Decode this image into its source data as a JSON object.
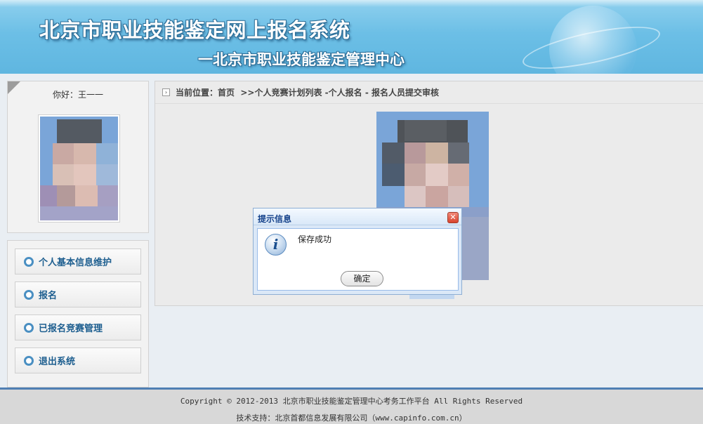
{
  "header": {
    "title": "北京市职业技能鉴定网上报名系统",
    "subtitle": "一北京市职业技能鉴定管理中心"
  },
  "sidebar": {
    "greeting": "你好：王一一",
    "menu": [
      {
        "label": "个人基本信息维护"
      },
      {
        "label": "报名"
      },
      {
        "label": "已报名竞赛管理"
      },
      {
        "label": "退出系统"
      }
    ]
  },
  "breadcrumb": {
    "prefix": "当前位置：",
    "path": "首页  >>个人竞赛计划列表 -个人报名 - 报名人员提交审核"
  },
  "dialog": {
    "title": "提示信息",
    "message": "保存成功",
    "ok_label": "确定",
    "close_glyph": "✕",
    "icon": "info-icon"
  },
  "footer": {
    "copyright": "Copyright © 2012-2013 北京市职业技能鉴定管理中心考务工作平台 All Rights Reserved",
    "support": "技术支持：北京首都信息发展有限公司（www.capinfo.com.cn）"
  },
  "colors": {
    "header_bg": "#6cbfe6",
    "nav_text": "#1d5e8f",
    "dialog_title": "#15428b",
    "footer_rule": "#4f7fb3"
  }
}
